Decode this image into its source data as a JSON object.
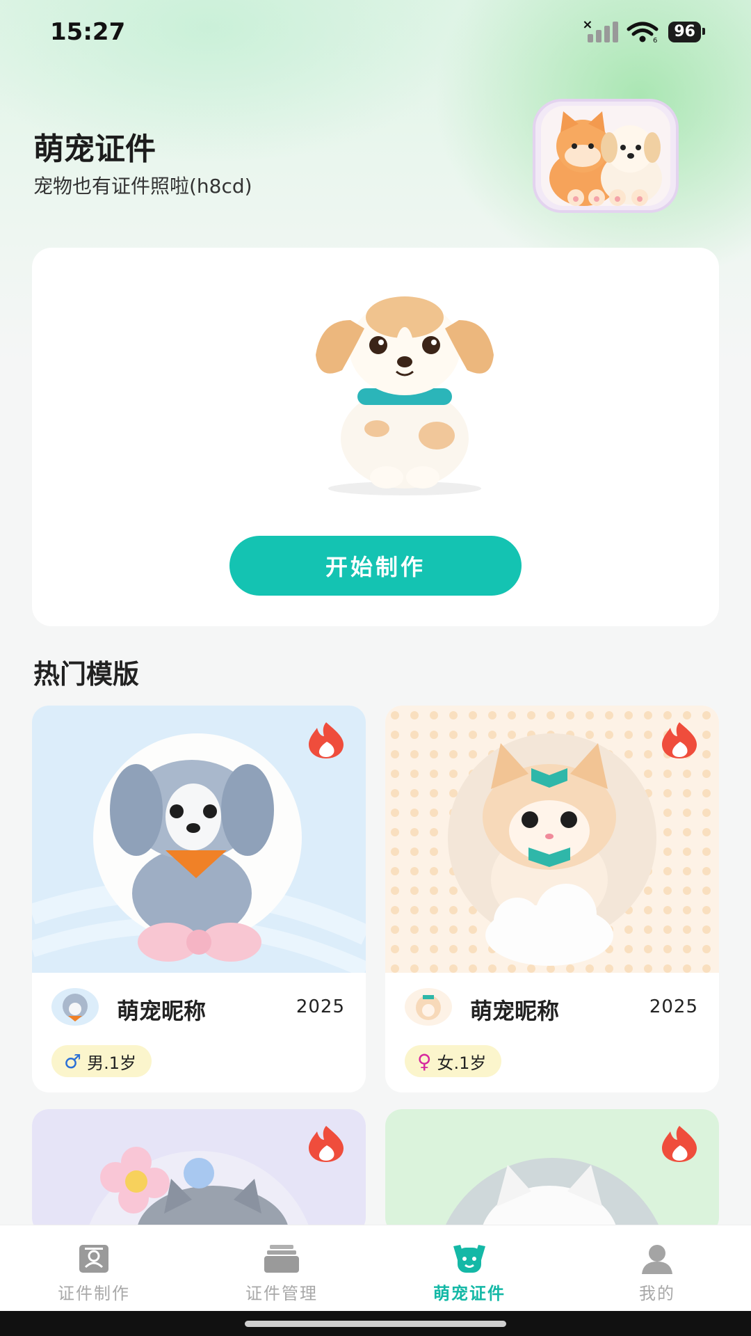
{
  "status": {
    "time": "15:27",
    "battery": "96"
  },
  "header": {
    "title": "萌宠证件",
    "subtitle": "宠物也有证件照啦(h8cd)"
  },
  "main_card": {
    "start_label": "开始制作"
  },
  "section": {
    "title": "热门模版"
  },
  "templates": [
    {
      "name": "萌宠昵称",
      "year": "2025",
      "gender_symbol": "♂",
      "tag": "男.1岁",
      "bg": "#dff0fb"
    },
    {
      "name": "萌宠昵称",
      "year": "2025",
      "gender_symbol": "♀",
      "tag": "女.1岁",
      "bg": "#fdf0e3"
    },
    {
      "bg": "#e6e4f7"
    },
    {
      "bg": "#dbf3dc"
    }
  ],
  "nav": {
    "items": [
      {
        "label": "证件制作",
        "icon": "id-card-icon"
      },
      {
        "label": "证件管理",
        "icon": "folder-stack-icon"
      },
      {
        "label": "萌宠证件",
        "icon": "dog-face-icon",
        "active": true
      },
      {
        "label": "我的",
        "icon": "user-icon"
      }
    ]
  },
  "colors": {
    "accent": "#14c3b2",
    "hot_badge": "#ef4d3c",
    "tag_bg": "#fbf5cc"
  }
}
